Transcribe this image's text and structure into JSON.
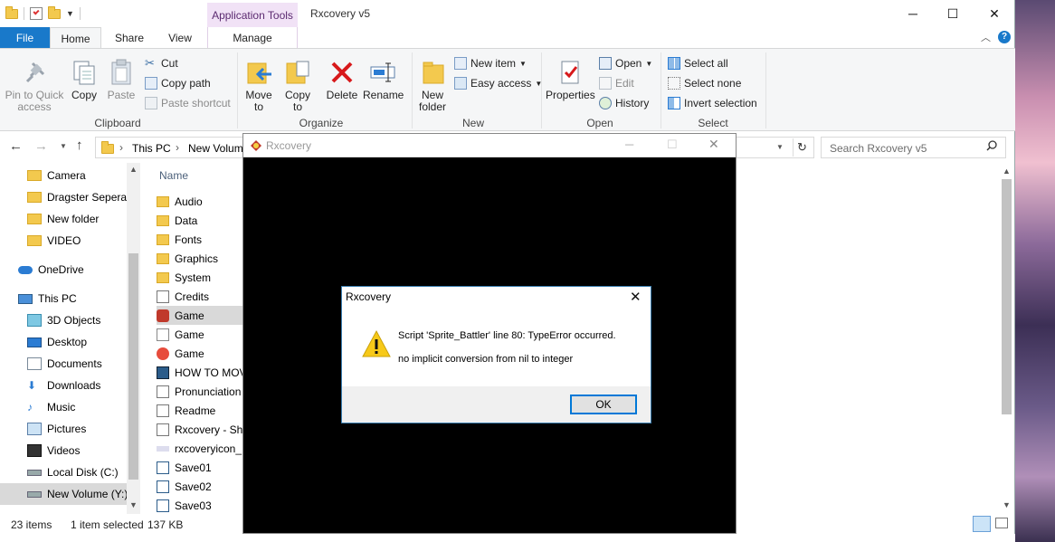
{
  "window": {
    "title": "Rxcovery v5",
    "context_tab": "Application Tools",
    "controls": {
      "minimize": "─",
      "maximize": "☐",
      "close": "✕"
    }
  },
  "ribbon_tabs": {
    "file": "File",
    "home": "Home",
    "share": "Share",
    "view": "View",
    "manage": "Manage"
  },
  "ribbon": {
    "clipboard": {
      "pin": "Pin to Quick access",
      "copy": "Copy",
      "paste": "Paste",
      "cut": "Cut",
      "copy_path": "Copy path",
      "paste_shortcut": "Paste shortcut",
      "label": "Clipboard"
    },
    "organize": {
      "move_to": "Move to",
      "copy_to": "Copy to",
      "delete": "Delete",
      "rename": "Rename",
      "label": "Organize"
    },
    "new": {
      "new_folder": "New folder",
      "new_item": "New item",
      "easy_access": "Easy access",
      "label": "New"
    },
    "open": {
      "properties": "Properties",
      "open": "Open",
      "edit": "Edit",
      "history": "History",
      "label": "Open"
    },
    "select": {
      "select_all": "Select all",
      "select_none": "Select none",
      "invert": "Invert selection",
      "label": "Select"
    }
  },
  "address": {
    "crumbs": [
      "This PC",
      "New Volume"
    ],
    "search_placeholder": "Search Rxcovery v5"
  },
  "nav_pane": [
    {
      "label": "Camera",
      "icon": "folder-icon"
    },
    {
      "label": "Dragster Seperat",
      "icon": "folder-icon"
    },
    {
      "label": "New folder",
      "icon": "folder-icon"
    },
    {
      "label": "VIDEO",
      "icon": "folder-icon"
    },
    {
      "label": "OneDrive",
      "icon": "cloud-icon"
    },
    {
      "label": "This PC",
      "icon": "computer-icon"
    },
    {
      "label": "3D Objects",
      "icon": "cube-icon"
    },
    {
      "label": "Desktop",
      "icon": "desktop-icon"
    },
    {
      "label": "Documents",
      "icon": "documents-icon"
    },
    {
      "label": "Downloads",
      "icon": "download-icon"
    },
    {
      "label": "Music",
      "icon": "music-icon"
    },
    {
      "label": "Pictures",
      "icon": "pictures-icon"
    },
    {
      "label": "Videos",
      "icon": "videos-icon"
    },
    {
      "label": "Local Disk (C:)",
      "icon": "drive-icon"
    },
    {
      "label": "New Volume (Y:)",
      "icon": "drive-icon"
    }
  ],
  "file_list": {
    "header": "Name",
    "items": [
      {
        "name": "Audio",
        "icon": "folder-icon"
      },
      {
        "name": "Data",
        "icon": "folder-icon"
      },
      {
        "name": "Fonts",
        "icon": "folder-icon"
      },
      {
        "name": "Graphics",
        "icon": "folder-icon"
      },
      {
        "name": "System",
        "icon": "folder-icon"
      },
      {
        "name": "Credits",
        "icon": "text-file-icon"
      },
      {
        "name": "Game",
        "icon": "game-exe-icon"
      },
      {
        "name": "Game",
        "icon": "game-config-icon"
      },
      {
        "name": "Game",
        "icon": "game-project-icon"
      },
      {
        "name": "HOW TO MOV",
        "icon": "image-file-icon"
      },
      {
        "name": "Pronunciation",
        "icon": "text-file-icon"
      },
      {
        "name": "Readme",
        "icon": "text-file-icon"
      },
      {
        "name": "Rxcovery - Sh",
        "icon": "shortcut-icon"
      },
      {
        "name": "rxcoveryicon_",
        "icon": "icon-file-icon"
      },
      {
        "name": "Save01",
        "icon": "save-file-icon"
      },
      {
        "name": "Save02",
        "icon": "save-file-icon"
      },
      {
        "name": "Save03",
        "icon": "save-file-icon"
      }
    ]
  },
  "status": {
    "count": "23 items",
    "selected": "1 item selected",
    "size": "137 KB"
  },
  "game_window": {
    "title": "Rxcovery"
  },
  "dialog": {
    "title": "Rxcovery",
    "line1": "Script 'Sprite_Battler' line 80: TypeError occurred.",
    "line2": "no implicit conversion from nil to integer",
    "ok": "OK"
  },
  "colors": {
    "accent": "#1979ca",
    "warning": "#f7c919",
    "delete": "#d7191b"
  }
}
